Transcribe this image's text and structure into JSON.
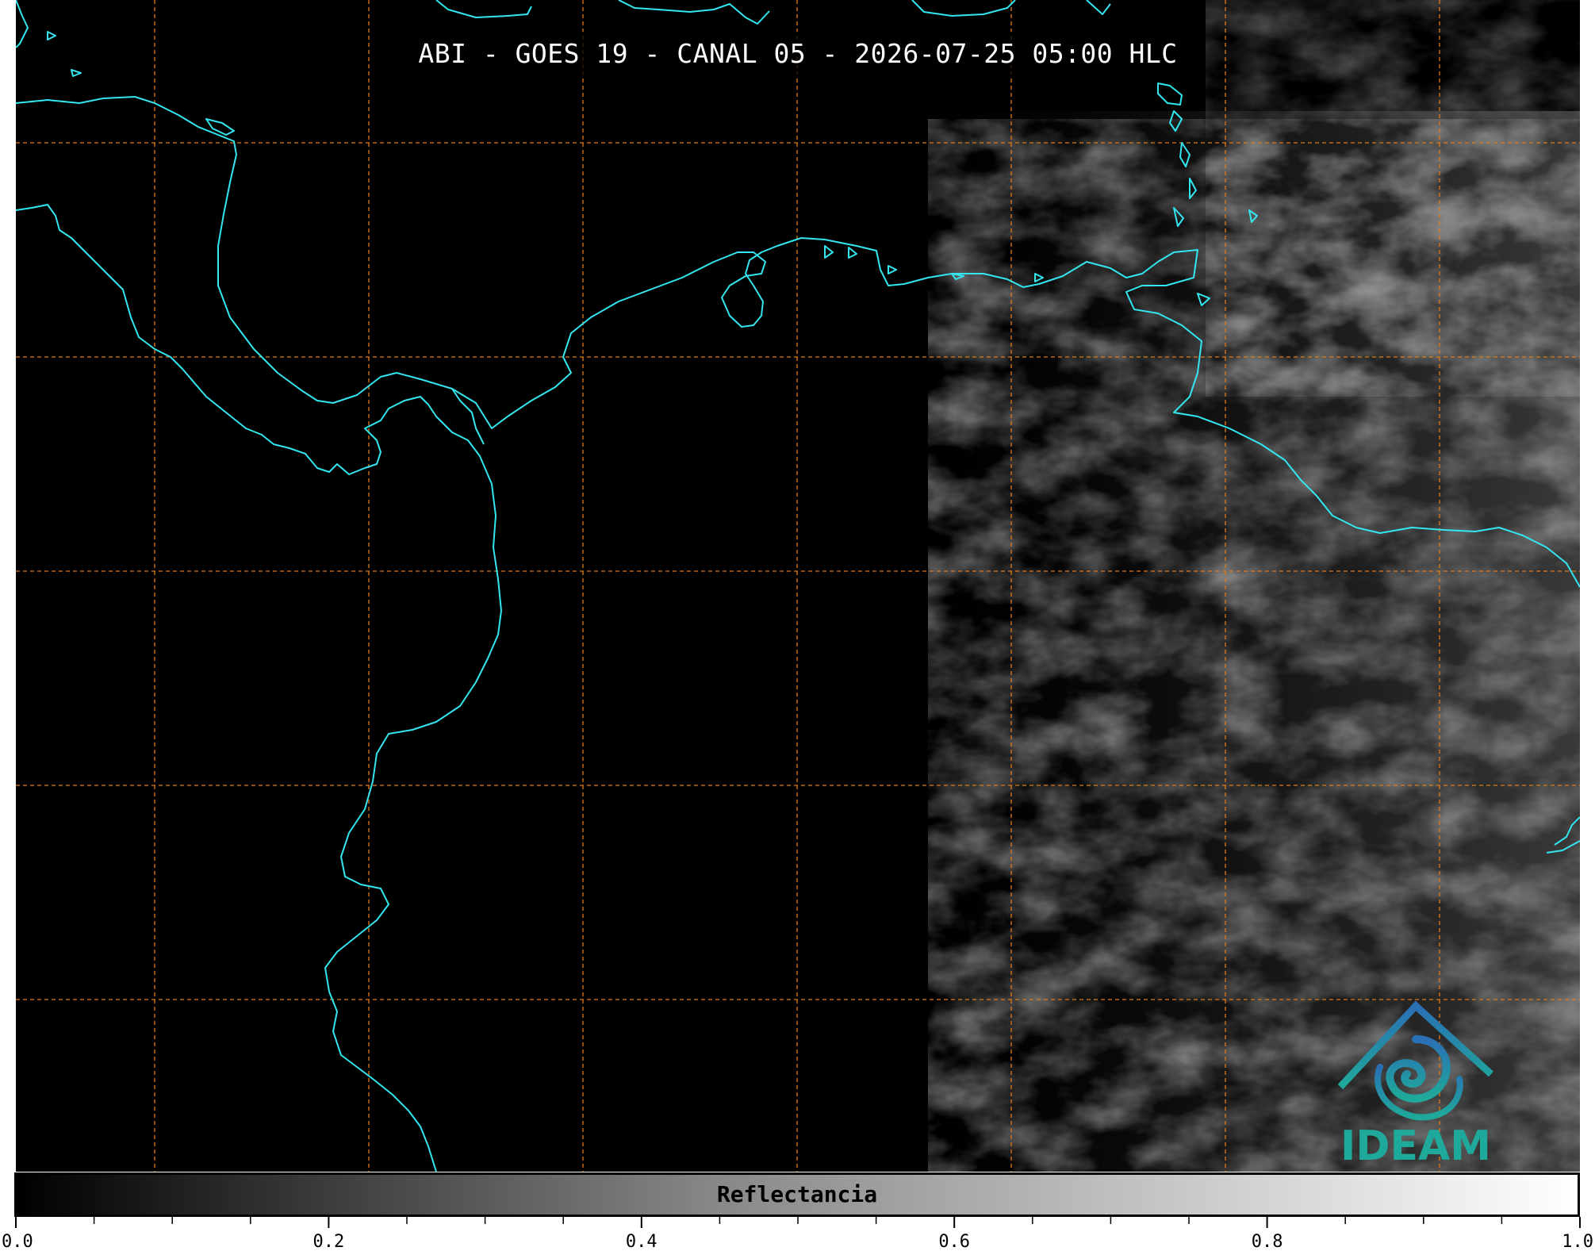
{
  "title": "ABI - GOES 19 - CANAL 05 - 2026-07-25 05:00 HLC",
  "colors": {
    "coastline": "#33e6f0",
    "gridline": "#e07a1a",
    "background": "#000000",
    "logo_blue": "#2a6fb5",
    "logo_teal": "#1fa99a"
  },
  "logo": {
    "text": "IDEAM",
    "icon": "ideam-logo-icon"
  },
  "colorbar": {
    "label": "Reflectancia",
    "range": [
      0.0,
      1.0
    ],
    "colormap": "gray",
    "major_ticks": [
      "0.0",
      "0.2",
      "0.4",
      "0.6",
      "0.8",
      "1.0"
    ],
    "major_values": [
      0.0,
      0.2,
      0.4,
      0.6,
      0.8,
      1.0
    ],
    "minor_step": 0.05
  },
  "map": {
    "grid": true,
    "grid_style": "dashed",
    "coastlines": true,
    "cloud_cover_side": "east"
  }
}
